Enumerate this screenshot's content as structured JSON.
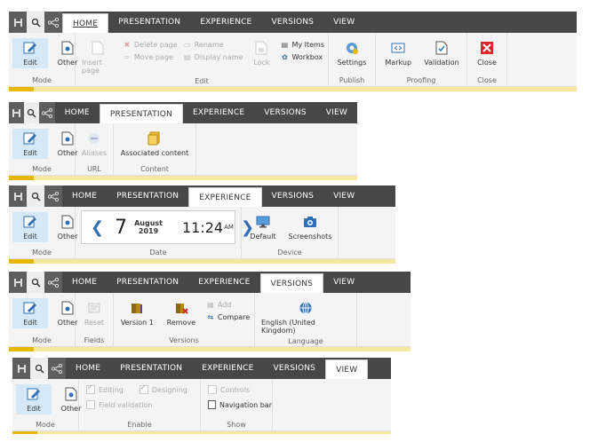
{
  "ribbons": [
    {
      "tabs": [
        "HOME",
        "PRESENTATION",
        "EXPERIENCE",
        "VERSIONS",
        "VIEW"
      ],
      "active_tab": "HOME",
      "groups": {
        "mode": {
          "label": "Mode",
          "edit": "Edit",
          "other": "Other"
        },
        "edit": {
          "label": "Edit",
          "insert_page": "Insert page",
          "delete_page": "Delete page",
          "move_page": "Move page",
          "rename": "Rename",
          "display_name": "Display name",
          "lock": "Lock",
          "my_items": "My Items",
          "workbox": "Workbox"
        },
        "publish": {
          "label": "Publish",
          "settings": "Settings"
        },
        "proofing": {
          "label": "Proofing",
          "markup": "Markup",
          "validation": "Validation"
        },
        "close": {
          "label": "Close",
          "close": "Close"
        }
      }
    },
    {
      "tabs": [
        "HOME",
        "PRESENTATION",
        "EXPERIENCE",
        "VERSIONS",
        "VIEW"
      ],
      "active_tab": "PRESENTATION",
      "groups": {
        "mode": {
          "label": "Mode",
          "edit": "Edit",
          "other": "Other"
        },
        "url": {
          "label": "URL",
          "aliases": "Aliases"
        },
        "content": {
          "label": "Content",
          "associated": "Associated content"
        }
      }
    },
    {
      "tabs": [
        "HOME",
        "PRESENTATION",
        "EXPERIENCE",
        "VERSIONS",
        "VIEW"
      ],
      "active_tab": "EXPERIENCE",
      "groups": {
        "mode": {
          "label": "Mode",
          "edit": "Edit",
          "other": "Other"
        },
        "date": {
          "label": "Date",
          "day": "7",
          "month": "August",
          "year": "2019",
          "time": "11:24",
          "ampm": "AM"
        },
        "device": {
          "label": "Device",
          "default": "Default",
          "screenshots": "Screenshots"
        }
      }
    },
    {
      "tabs": [
        "HOME",
        "PRESENTATION",
        "EXPERIENCE",
        "VERSIONS",
        "VIEW"
      ],
      "active_tab": "VERSIONS",
      "groups": {
        "mode": {
          "label": "Mode",
          "edit": "Edit",
          "other": "Other"
        },
        "fields": {
          "label": "Fields",
          "reset": "Reset"
        },
        "versions": {
          "label": "Versions",
          "version": "Version 1",
          "remove": "Remove",
          "add": "Add",
          "compare": "Compare"
        },
        "language": {
          "label": "Language",
          "lang": "English (United Kingdom)"
        }
      }
    },
    {
      "tabs": [
        "HOME",
        "PRESENTATION",
        "EXPERIENCE",
        "VERSIONS",
        "VIEW"
      ],
      "active_tab": "VIEW",
      "groups": {
        "mode": {
          "label": "Mode",
          "edit": "Edit",
          "other": "Other"
        },
        "enable": {
          "label": "Enable",
          "editing": "Editing",
          "designing": "Designing",
          "field_validation": "Field validation"
        },
        "show": {
          "label": "Show",
          "controls": "Controls",
          "navigation_bar": "Navigation bar"
        }
      }
    }
  ],
  "colors": {
    "tabbar": "#474747",
    "accent_bar": "#e8b800",
    "accent_bar_track": "#f5e6a0",
    "active_mode": "#d4e8f7",
    "link_blue": "#2f6fb5",
    "close_red": "#d9262c"
  }
}
